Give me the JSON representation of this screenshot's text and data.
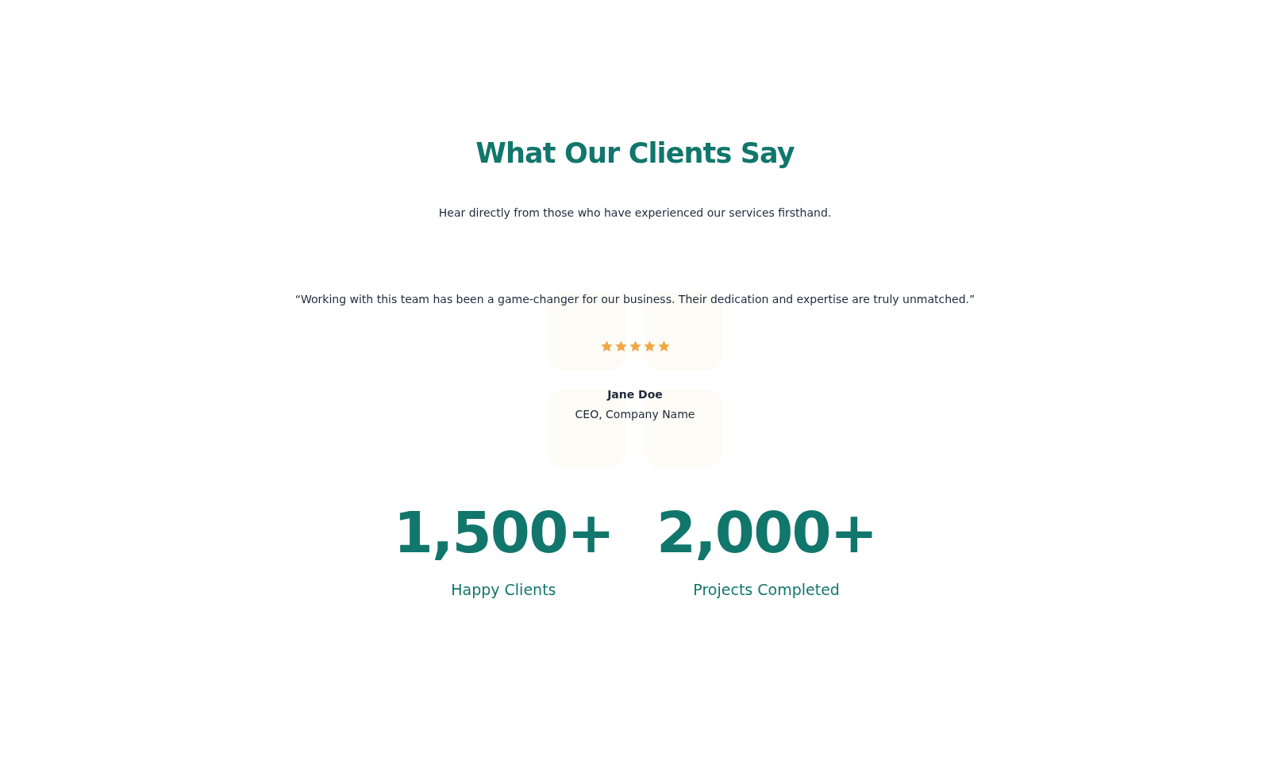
{
  "section": {
    "title": "What Our Clients Say",
    "subtitle": "Hear directly from those who have experienced our services firsthand."
  },
  "testimonial": {
    "quote": "“Working with this team has been a game-changer for our business. Their dedication and expertise are truly unmatched.”",
    "stars": 5,
    "name": "Jane Doe",
    "role": "CEO, Company Name"
  },
  "stats": [
    {
      "value": "1,500+",
      "label": "Happy Clients"
    },
    {
      "value": "2,000+",
      "label": "Projects Completed"
    }
  ]
}
